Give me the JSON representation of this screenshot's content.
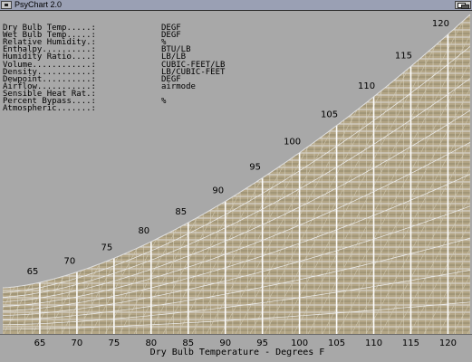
{
  "window": {
    "title": "PsyChart 2.0"
  },
  "readouts": [
    {
      "label": "Dry Bulb Temp.....:",
      "value": "DEGF"
    },
    {
      "label": "Wet Bulb Temp.....:",
      "value": "DEGF"
    },
    {
      "label": "Relative Humidity.:",
      "value": "%"
    },
    {
      "label": "Enthalpy..........:",
      "value": "BTU/LB"
    },
    {
      "label": "Humidity Ratio....:",
      "value": "LB/LB"
    },
    {
      "label": "Volume............:",
      "value": "CUBIC-FEET/LB"
    },
    {
      "label": "Density...........:",
      "value": "LB/CUBIC-FEET"
    },
    {
      "label": "Dewpoint..........:",
      "value": "DEGF"
    },
    {
      "label": "Airflow...........:",
      "value": "airmode"
    },
    {
      "label": "Sensible Heat Rat.:",
      "value": ""
    },
    {
      "label": "Percent Bypass....:",
      "value": "%"
    },
    {
      "label": "Atmospheric.......:",
      "value": ""
    }
  ],
  "chart": {
    "x_axis_label": "Dry Bulb Temperature - Degrees F",
    "x_ticks": [
      "65",
      "70",
      "75",
      "80",
      "85",
      "90",
      "95",
      "100",
      "105",
      "110",
      "115",
      "120"
    ],
    "saturation_labels": [
      "65",
      "70",
      "75",
      "80",
      "85",
      "90",
      "95",
      "100",
      "105",
      "110",
      "115",
      "120"
    ],
    "colors": {
      "background": "#a8a8a8",
      "chart_fill": "#b3a585",
      "grid_major": "#ffffff",
      "grid_minor": "#dcdcdc",
      "text": "#000000"
    }
  }
}
